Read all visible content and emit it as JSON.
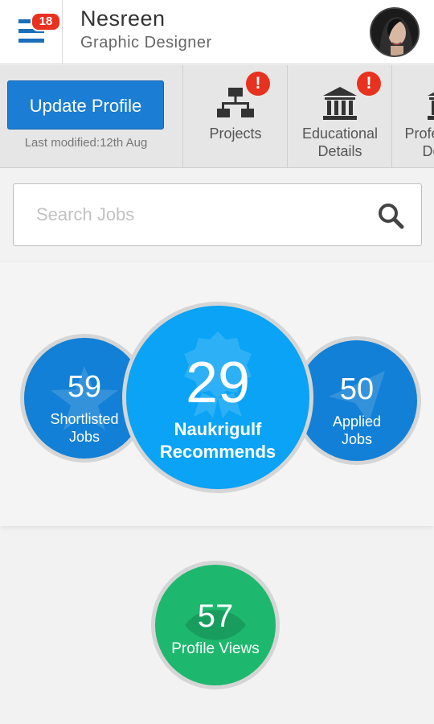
{
  "header": {
    "notification_count": "18",
    "user_name": "Nesreen",
    "user_title": "Graphic Designer",
    "menu_icon": "hamburger-menu-icon",
    "avatar_icon": "profile-avatar"
  },
  "profile_strip": {
    "update_button": "Update Profile",
    "last_modified": "Last modified:12th Aug",
    "tiles": [
      {
        "label": "Projects",
        "icon": "org-chart-icon",
        "alert": "!"
      },
      {
        "label": "Educational Details",
        "icon": "institution-icon",
        "alert": "!"
      },
      {
        "label": "Professional Details",
        "icon": "institution-icon"
      }
    ]
  },
  "search": {
    "placeholder": "Search Jobs",
    "icon": "search-icon"
  },
  "stats": {
    "shortlisted": {
      "count": "59",
      "label_line1": "Shortlisted",
      "label_line2": "Jobs"
    },
    "recommends": {
      "count": "29",
      "label_line1": "Naukrigulf",
      "label_line2": "Recommends"
    },
    "applied": {
      "count": "50",
      "label_line1": "Applied",
      "label_line2": "Jobs"
    },
    "profile_views": {
      "count": "57",
      "label": "Profile Views"
    }
  },
  "colors": {
    "accent_blue": "#1b7dd3",
    "recommend_blue": "#0aa3f5",
    "side_blue": "#1280d6",
    "green": "#1db86e",
    "alert_red": "#e8321f"
  }
}
